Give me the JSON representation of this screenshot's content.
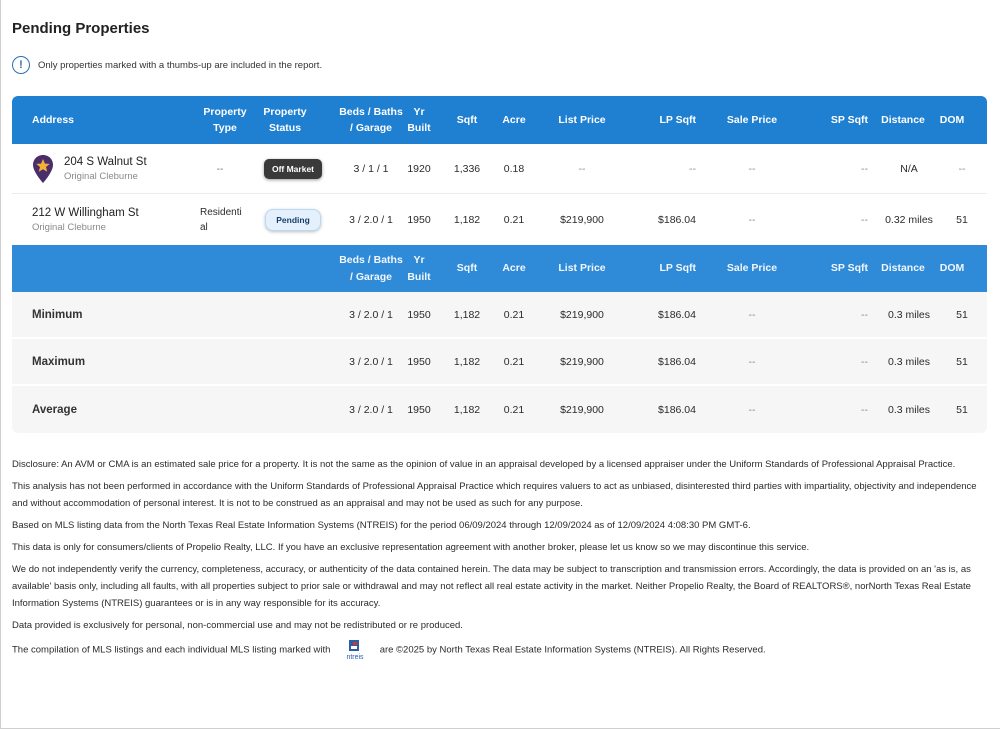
{
  "page": {
    "title": "Pending Properties",
    "info_text": "Only properties marked with a thumbs-up are included in the report."
  },
  "colors": {
    "header": "#1f7fd1",
    "subheader": "#2f8ad8",
    "pin": "#4b2d6b",
    "pin_star": "#f2b134"
  },
  "columns": {
    "address": "Address",
    "type": "Property Type",
    "status": "Property Status",
    "bbg": "Beds / Baths / Garage",
    "yr": "Yr Built",
    "sqft": "Sqft",
    "acre": "Acre",
    "list_price": "List Price",
    "lp_sqft": "LP Sqft",
    "sale_price": "Sale Price",
    "sp_sqft": "SP Sqft",
    "distance": "Distance",
    "dom": "DOM"
  },
  "properties": [
    {
      "address": "204 S Walnut St",
      "sub": "Original Cleburne",
      "type": "--",
      "status": "Off Market",
      "bbg": "3 / 1 / 1",
      "yr": "1920",
      "sqft": "1,336",
      "acre": "0.18",
      "list_price": "--",
      "lp_sqft": "--",
      "sale_price": "--",
      "sp_sqft": "--",
      "distance": "N/A",
      "dom": "--"
    },
    {
      "address": "212 W Willingham St",
      "sub": "Original Cleburne",
      "type": "Residential",
      "status": "Pending",
      "bbg": "3 / 2.0 / 1",
      "yr": "1950",
      "sqft": "1,182",
      "acre": "0.21",
      "list_price": "$219,900",
      "lp_sqft": "$186.04",
      "sale_price": "--",
      "sp_sqft": "--",
      "distance": "0.32 miles",
      "dom": "51"
    }
  ],
  "stats": [
    {
      "label": "Minimum",
      "bbg": "3 / 2.0 / 1",
      "yr": "1950",
      "sqft": "1,182",
      "acre": "0.21",
      "list_price": "$219,900",
      "lp_sqft": "$186.04",
      "sale_price": "--",
      "sp_sqft": "--",
      "distance": "0.3 miles",
      "dom": "51"
    },
    {
      "label": "Maximum",
      "bbg": "3 / 2.0 / 1",
      "yr": "1950",
      "sqft": "1,182",
      "acre": "0.21",
      "list_price": "$219,900",
      "lp_sqft": "$186.04",
      "sale_price": "--",
      "sp_sqft": "--",
      "distance": "0.3 miles",
      "dom": "51"
    },
    {
      "label": "Average",
      "bbg": "3 / 2.0 / 1",
      "yr": "1950",
      "sqft": "1,182",
      "acre": "0.21",
      "list_price": "$219,900",
      "lp_sqft": "$186.04",
      "sale_price": "--",
      "sp_sqft": "--",
      "distance": "0.3 miles",
      "dom": "51"
    }
  ],
  "disclaimer": [
    "Disclosure: An AVM or CMA is an estimated sale price for a property. It is not the same as the opinion of value in an appraisal developed by a licensed appraiser under the Uniform Standards of Professional Appraisal Practice.",
    "This analysis has not been performed in accordance with the Uniform Standards of Professional Appraisal Practice which requires valuers to act as unbiased, disinterested third parties with impartiality, objectivity and independence and without accommodation of personal interest. It is not to be construed as an appraisal and may not be used as such for any purpose.",
    "Based on MLS listing data from the North Texas Real Estate Information Systems (NTREIS) for the period 06/09/2024 through 12/09/2024 as of 12/09/2024 4:08:30 PM GMT-6.",
    "This data is only for consumers/clients of Propelio Realty, LLC. If you have an exclusive representation agreement with another broker, please let us know so we may discontinue this service.",
    "We do not independently verify the currency, completeness, accuracy, or authenticity of the data contained herein. The data may be subject to transcription and transmission errors. Accordingly, the data is provided on an 'as is, as available' basis only, including all faults, with all properties subject to prior sale or withdrawal and may not reflect all real estate activity in the market. Neither Propelio Realty, the Board of REALTORS®, norNorth Texas Real Estate Information Systems (NTREIS) guarantees or is in any way responsible for its accuracy.",
    "Data provided is exclusively for personal, non-commercial use and may not be redistributed or re produced."
  ],
  "compilation": {
    "before": "The compilation of MLS listings and each individual MLS listing marked with",
    "logo_text": "ntreis",
    "after": "are ©2025 by North Texas Real Estate Information Systems (NTREIS). All Rights Reserved."
  }
}
